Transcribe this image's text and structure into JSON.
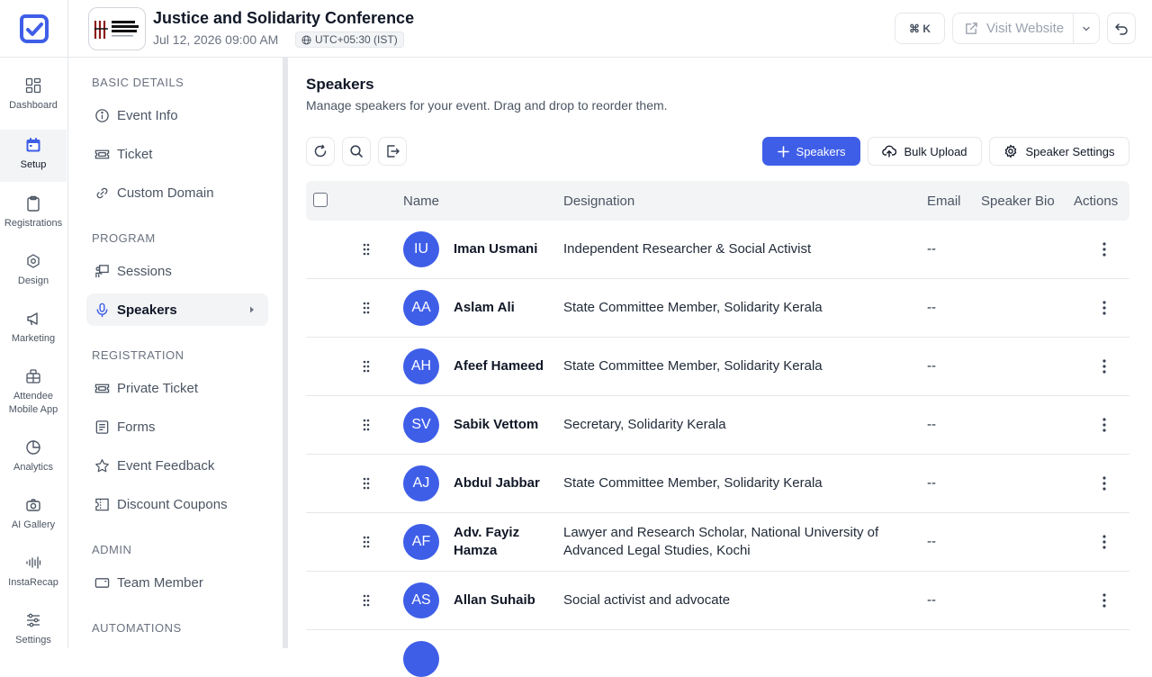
{
  "header": {
    "event_title": "Justice and Solidarity Conference",
    "event_date": "Jul 12, 2026 09:00 AM",
    "timezone": "UTC+05:30 (IST)",
    "shortcut_label": "⌘ K",
    "visit_website_label": "Visit Website",
    "event_logo_text": "JUSTICE & SOLIDARITY CONFERENCE"
  },
  "rail": {
    "items": [
      {
        "label": "Dashboard",
        "icon": "dashboard-icon"
      },
      {
        "label": "Setup",
        "icon": "calendar-icon",
        "active": true
      },
      {
        "label": "Registrations",
        "icon": "clipboard-icon"
      },
      {
        "label": "Design",
        "icon": "design-icon"
      },
      {
        "label": "Marketing",
        "icon": "megaphone-icon"
      },
      {
        "label": "Attendee Mobile App",
        "icon": "mobile-app-icon"
      },
      {
        "label": "Analytics",
        "icon": "pie-chart-icon"
      },
      {
        "label": "AI Gallery",
        "icon": "camera-icon"
      },
      {
        "label": "InstaRecap",
        "icon": "waveform-icon"
      },
      {
        "label": "Settings",
        "icon": "sliders-icon"
      }
    ]
  },
  "subnav": {
    "sections": {
      "basic": "BASIC DETAILS",
      "program": "PROGRAM",
      "registration": "REGISTRATION",
      "admin": "ADMIN",
      "automations": "AUTOMATIONS"
    },
    "items": {
      "event_info": "Event Info",
      "ticket": "Ticket",
      "custom_domain": "Custom Domain",
      "sessions": "Sessions",
      "speakers": "Speakers",
      "private_ticket": "Private Ticket",
      "forms": "Forms",
      "event_feedback": "Event Feedback",
      "discount_coupons": "Discount Coupons",
      "team_member": "Team Member"
    }
  },
  "main": {
    "title": "Speakers",
    "subtitle": "Manage speakers for your event. Drag and drop to reorder them.",
    "add_speakers_label": "Speakers",
    "bulk_upload_label": "Bulk Upload",
    "speaker_settings_label": "Speaker Settings",
    "accent_color": "#3f5ee8"
  },
  "table": {
    "columns": [
      "Name",
      "Designation",
      "Email",
      "Speaker Bio",
      "Actions"
    ],
    "rows": [
      {
        "initials": "IU",
        "name": "Iman Usmani",
        "designation": "Independent Researcher & Social Activist",
        "email": "--"
      },
      {
        "initials": "AA",
        "name": "Aslam Ali",
        "designation": "State Committee Member, Solidarity Kerala",
        "email": "--"
      },
      {
        "initials": "AH",
        "name": "Afeef Hameed",
        "designation": "State Committee Member, Solidarity Kerala",
        "email": "--"
      },
      {
        "initials": "SV",
        "name": "Sabik Vettom",
        "designation": "Secretary, Solidarity Kerala",
        "email": "--"
      },
      {
        "initials": "AJ",
        "name": "Abdul Jabbar",
        "designation": "State Committee Member, Solidarity Kerala",
        "email": "--"
      },
      {
        "initials": "AF",
        "name": "Adv. Fayiz Hamza",
        "designation": "Lawyer and Research Scholar, National University of Advanced Legal Studies, Kochi",
        "email": "--"
      },
      {
        "initials": "AS",
        "name": "Allan Suhaib",
        "designation": "Social activist and advocate",
        "email": "--"
      }
    ]
  }
}
